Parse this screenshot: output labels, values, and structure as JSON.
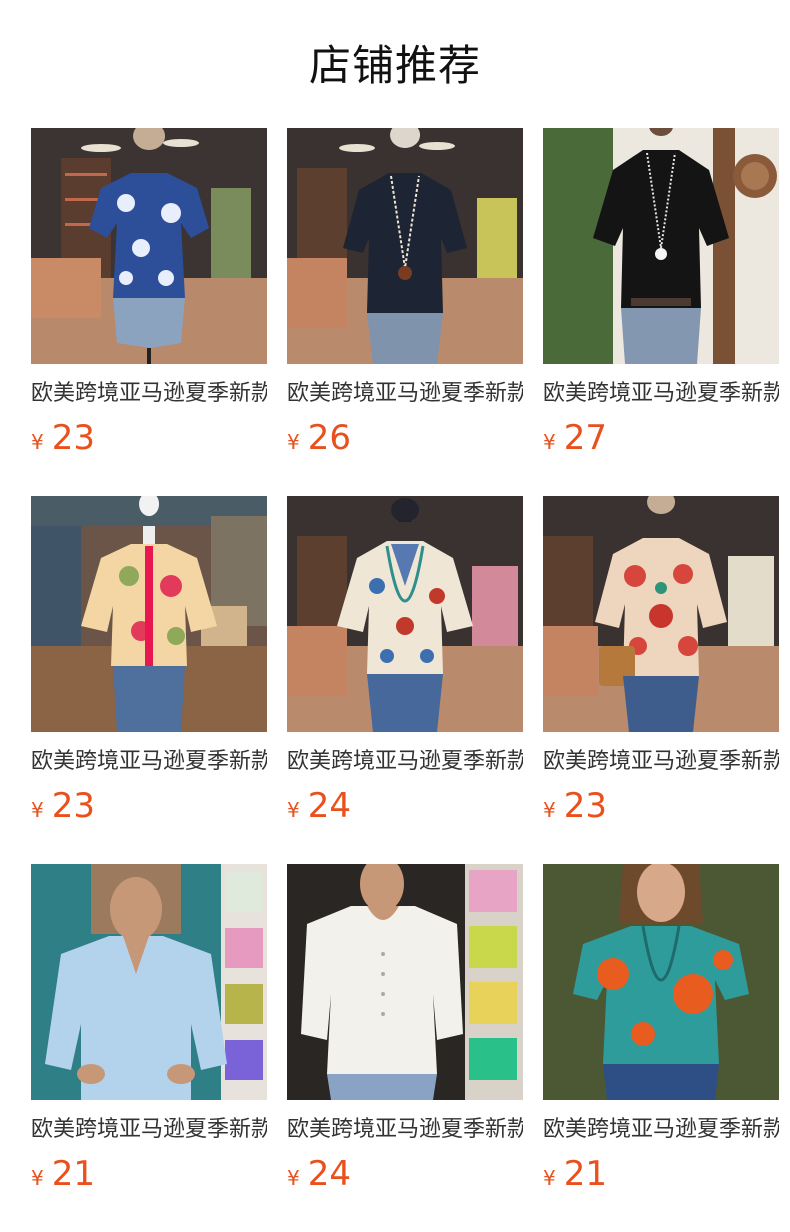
{
  "header": {
    "title": "店铺推荐"
  },
  "colors": {
    "price": "#e8511e",
    "title_text": "#333333"
  },
  "products": [
    {
      "title": "欧美跨境亚马逊夏季新款",
      "currency": "¥",
      "price": "23",
      "image": "blue-floral-ruffle-blouse-on-mannequin"
    },
    {
      "title": "欧美跨境亚马逊夏季新款",
      "currency": "¥",
      "price": "26",
      "image": "navy-puff-sleeve-blouse-with-necklace"
    },
    {
      "title": "欧美跨境亚马逊夏季新款",
      "currency": "¥",
      "price": "27",
      "image": "black-blouse-with-flower-necklace"
    },
    {
      "title": "欧美跨境亚马逊夏季新款",
      "currency": "¥",
      "price": "23",
      "image": "pink-green-floral-ruffle-blouse"
    },
    {
      "title": "欧美跨境亚马逊夏季新款",
      "currency": "¥",
      "price": "24",
      "image": "cream-embroidered-peasant-blouse"
    },
    {
      "title": "欧美跨境亚马逊夏季新款",
      "currency": "¥",
      "price": "23",
      "image": "red-floral-blouse-with-crossbody-bag"
    },
    {
      "title": "欧美跨境亚马逊夏季新款",
      "currency": "¥",
      "price": "21",
      "image": "light-blue-linen-v-neck-top"
    },
    {
      "title": "欧美跨境亚马逊夏季新款",
      "currency": "¥",
      "price": "24",
      "image": "white-button-linen-top"
    },
    {
      "title": "欧美跨境亚马逊夏季新款",
      "currency": "¥",
      "price": "21",
      "image": "teal-orange-floral-tee"
    }
  ]
}
